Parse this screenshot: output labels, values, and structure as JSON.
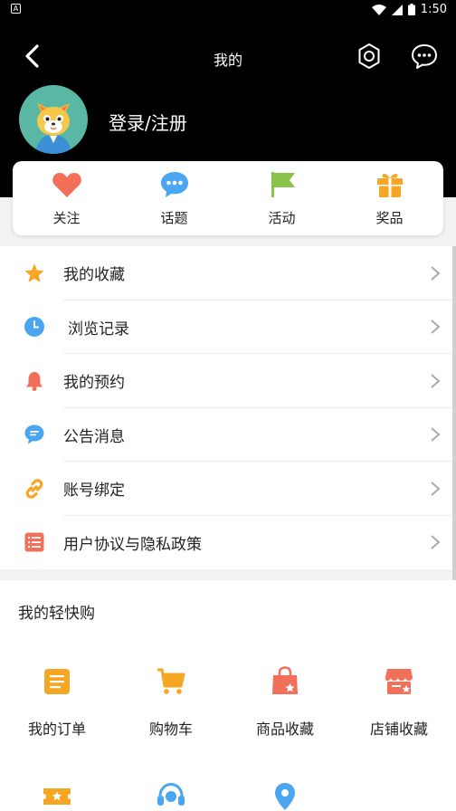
{
  "status": {
    "notification_icon": "A",
    "time": "1:50"
  },
  "header": {
    "title": "我的",
    "login_label": "登录/注册",
    "icons": [
      "back-icon",
      "settings-icon",
      "message-icon"
    ]
  },
  "quick": [
    {
      "label": "关注",
      "icon": "heart-icon",
      "color": "#f2705a"
    },
    {
      "label": "话题",
      "icon": "chat-bubble-icon",
      "color": "#4aa6f0"
    },
    {
      "label": "活动",
      "icon": "flag-icon",
      "color": "#8bc34a"
    },
    {
      "label": "奖品",
      "icon": "gift-icon",
      "color": "#f5a623"
    }
  ],
  "menu": [
    {
      "label": "我的收藏",
      "icon": "star-icon",
      "color": "#f5a623"
    },
    {
      "label": "浏览记录",
      "icon": "clock-icon",
      "color": "#4aa6f0"
    },
    {
      "label": "我的预约",
      "icon": "bell-icon",
      "color": "#f2705a"
    },
    {
      "label": "公告消息",
      "icon": "message-icon",
      "color": "#4aa6f0"
    },
    {
      "label": "账号绑定",
      "icon": "link-icon",
      "color": "#f5a623"
    },
    {
      "label": "用户协议与隐私政策",
      "icon": "document-list-icon",
      "color": "#f2705a"
    }
  ],
  "shop": {
    "title": "我的轻快购",
    "items": [
      {
        "label": "我的订单",
        "icon": "order-icon",
        "color": "#f5a623"
      },
      {
        "label": "购物车",
        "icon": "cart-icon",
        "color": "#f5a623"
      },
      {
        "label": "商品收藏",
        "icon": "bag-star-icon",
        "color": "#f2705a"
      },
      {
        "label": "店铺收藏",
        "icon": "store-star-icon",
        "color": "#f2705a"
      }
    ],
    "row2": [
      {
        "icon": "coupon-icon",
        "color": "#f5a623"
      },
      {
        "icon": "service-headset-icon",
        "color": "#4aa6f0"
      },
      {
        "icon": "location-pin-icon",
        "color": "#4aa6f0"
      }
    ]
  }
}
